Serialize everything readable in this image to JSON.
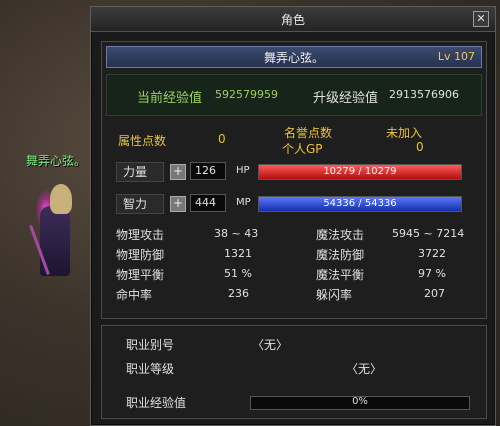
{
  "scene": {
    "character_name": "舞弄心弦。"
  },
  "window": {
    "title": "角色",
    "close_label": "✕"
  },
  "header": {
    "name": "舞弄心弦。",
    "level": "Lv 107"
  },
  "experience": {
    "current_label": "当前经验值",
    "current_value": "592579959",
    "levelup_label": "升级经验值",
    "levelup_value": "2913576906"
  },
  "points": {
    "attr_label": "属性点数",
    "attr_value": "0",
    "fame_label": "名誉点数",
    "not_joined": "未加入",
    "gp_label": "个人GP",
    "gp_value": "0"
  },
  "stats": {
    "strength_label": "力量",
    "strength_value": "126",
    "intellect_label": "智力",
    "intellect_value": "444",
    "plus_label": "+",
    "hp_label": "HP",
    "hp_text": "10279 / 10279",
    "hp_fraction": 1.0,
    "mp_label": "MP",
    "mp_text": "54336 / 54336",
    "mp_fraction": 1.0,
    "phys_atk_label": "物理攻击",
    "phys_atk_value": "38 ~ 43",
    "mag_atk_label": "魔法攻击",
    "mag_atk_value": "5945 ~ 7214",
    "phys_def_label": "物理防御",
    "phys_def_value": "1321",
    "mag_def_label": "魔法防御",
    "mag_def_value": "3722",
    "phys_bal_label": "物理平衡",
    "phys_bal_value": "51 %",
    "mag_bal_label": "魔法平衡",
    "mag_bal_value": "97 %",
    "hit_label": "命中率",
    "hit_value": "236",
    "dodge_label": "躲闪率",
    "dodge_value": "207"
  },
  "job": {
    "alias_label": "职业别号",
    "alias_value": "〈无〉",
    "grade_label": "职业等级",
    "grade_value": "〈无〉",
    "exp_label": "职业经验值",
    "exp_text": "0%",
    "exp_fraction": 0.0
  },
  "colors": {
    "hp_fill": "#d42020",
    "mp_fill": "#2a4ad0",
    "level_text": "#f0c850",
    "yellow_label": "#e8c23a",
    "green_value": "#9bd163",
    "name_green": "#7cf07c"
  }
}
